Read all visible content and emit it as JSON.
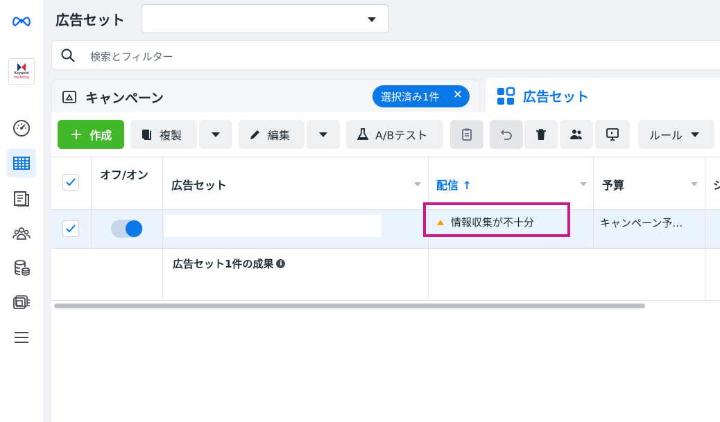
{
  "header": {
    "title": "広告セット",
    "selector_value": ""
  },
  "search": {
    "placeholder": "検索とフィルター"
  },
  "tabs": {
    "campaign": {
      "label": "キャンペーン",
      "chip": "選択済み1件",
      "chip_close": "✕"
    },
    "adsets": {
      "label": "広告セット"
    }
  },
  "sidebar": {
    "logo": "meta-logo",
    "brand_line1": "Keyword",
    "brand_line2": "marketing",
    "items": [
      "gauge-icon",
      "table-grid-icon",
      "pages-icon",
      "audience-icon",
      "database-icon",
      "media-library-icon",
      "menu-icon"
    ]
  },
  "toolbar": {
    "create": "作成",
    "duplicate": "複製",
    "edit": "編集",
    "ab_test": "A/Bテスト",
    "rules": "ルール"
  },
  "table": {
    "columns": {
      "onoff": "オフ/オン",
      "name": "広告セット",
      "delivery": "配信 ↑",
      "budget": "予算",
      "partial": "シ"
    },
    "row": {
      "delivery_status": "情報収集が不十分",
      "budget": "キャンペーン予…"
    },
    "summary": "広告セット1件の成果",
    "info_icon": "i"
  },
  "colors": {
    "accent": "#0a78e6",
    "create": "#42b72a",
    "highlight": "#c41d8a",
    "warning": "#f2a100"
  }
}
